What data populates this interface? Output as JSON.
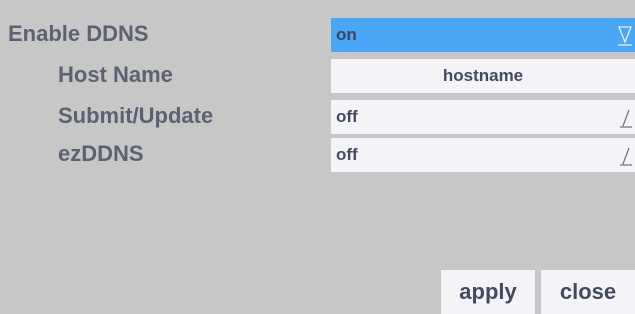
{
  "settings": {
    "enable_ddns": {
      "label": "Enable DDNS",
      "value": "on"
    },
    "host_name": {
      "label": "Host Name",
      "value": "hostname"
    },
    "submit_update": {
      "label": "Submit/Update",
      "value": "off"
    },
    "ezddns": {
      "label": "ezDDNS",
      "value": "off"
    }
  },
  "buttons": {
    "apply": "apply",
    "close": "close"
  },
  "icons": {
    "enable_ddns_dropdown": "triangle-down-icon",
    "submit_update_dropdown": "slash-dropdown-icon",
    "ezddns_dropdown": "slash-dropdown-icon"
  },
  "colors": {
    "background": "#c7c7c7",
    "label_text": "#5d6272",
    "field_bg": "#f4f4f8",
    "selected_field_bg": "#4aa7f5",
    "field_text": "#434b5e"
  }
}
